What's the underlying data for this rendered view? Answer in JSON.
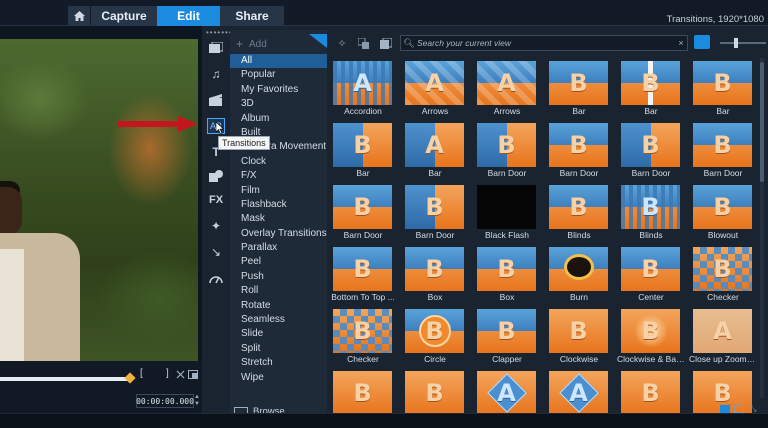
{
  "topbar": {
    "tabs": [
      {
        "label": "Capture"
      },
      {
        "label": "Edit"
      },
      {
        "label": "Share"
      }
    ],
    "project_info": "Transitions, 1920*1080"
  },
  "player": {
    "timecode": "00:00:00.000",
    "mark_in_glyph": "[",
    "mark_out_glyph": "]"
  },
  "library": {
    "add_label": "Add",
    "browse_label": "Browse",
    "search_placeholder": "Search your current view",
    "tooltip": "Transitions",
    "categories": [
      "All",
      "Popular",
      "My Favorites",
      "3D",
      "Album",
      "Built",
      "Camera Movement",
      "Clock",
      "F/X",
      "Film",
      "Flashback",
      "Mask",
      "Overlay Transitions",
      "Parallax",
      "Peel",
      "Push",
      "Roll",
      "Rotate",
      "Seamless",
      "Slide",
      "Split",
      "Stretch",
      "Wipe"
    ],
    "selected_category": "All",
    "side_icons": [
      "media-icon",
      "instant-project-icon",
      "sound-icon",
      "transitions-icon",
      "title-icon",
      "graphics-icon",
      "fx-icon",
      "effects-icon",
      "path-icon",
      "speed-icon"
    ],
    "fx_text": "FX",
    "thumbnails": [
      {
        "label": "Accordion",
        "style": "vbars",
        "letter": "A"
      },
      {
        "label": "Arrows",
        "style": "stripes",
        "letter": "A"
      },
      {
        "label": "Arrows",
        "style": "stripes",
        "letter": "A"
      },
      {
        "label": "Bar",
        "style": "sky",
        "letter": "B"
      },
      {
        "label": "Bar",
        "style": "split",
        "letter": "B"
      },
      {
        "label": "Bar",
        "style": "sky",
        "letter": "B"
      },
      {
        "label": "Bar",
        "style": "half",
        "letter": "B"
      },
      {
        "label": "Bar",
        "style": "half",
        "letter": "A"
      },
      {
        "label": "Barn Door",
        "style": "half",
        "letter": "B"
      },
      {
        "label": "Barn Door",
        "style": "sky",
        "letter": "B"
      },
      {
        "label": "Barn Door",
        "style": "half",
        "letter": "B"
      },
      {
        "label": "Barn Door",
        "style": "sky",
        "letter": "B"
      },
      {
        "label": "Barn Door",
        "style": "sky",
        "letter": "B"
      },
      {
        "label": "Barn Door",
        "style": "half",
        "letter": "B"
      },
      {
        "label": "Black Flash",
        "style": "black",
        "letter": ""
      },
      {
        "label": "Blinds",
        "style": "sky",
        "letter": "B"
      },
      {
        "label": "Blinds",
        "style": "vbars",
        "letter": "B"
      },
      {
        "label": "Blowout",
        "style": "sky",
        "letter": "B"
      },
      {
        "label": "Bottom To Top ...",
        "style": "sky",
        "letter": "B"
      },
      {
        "label": "Box",
        "style": "sky",
        "letter": "B"
      },
      {
        "label": "Box",
        "style": "sky",
        "letter": "B"
      },
      {
        "label": "Burn",
        "style": "hole",
        "letter": ""
      },
      {
        "label": "Center",
        "style": "sky",
        "letter": "B"
      },
      {
        "label": "Checker",
        "style": "checks",
        "letter": "B"
      },
      {
        "label": "Checker",
        "style": "checks",
        "letter": "B"
      },
      {
        "label": "Circle",
        "style": "circle",
        "letter": "B"
      },
      {
        "label": "Clapper",
        "style": "sky",
        "letter": "B"
      },
      {
        "label": "Clockwise",
        "style": "plain",
        "letter": "B"
      },
      {
        "label": "Clockwise & Bala...",
        "style": "glow",
        "letter": "B"
      },
      {
        "label": "Close up Zoom I...",
        "style": "dim",
        "letter": "A"
      },
      {
        "label": "",
        "style": "plain",
        "letter": "B"
      },
      {
        "label": "",
        "style": "plain",
        "letter": "B"
      },
      {
        "label": "",
        "style": "diamond",
        "letter": "A"
      },
      {
        "label": "",
        "style": "diamond",
        "letter": "A"
      },
      {
        "label": "",
        "style": "plain",
        "letter": "B"
      },
      {
        "label": "",
        "style": "plain",
        "letter": "B"
      }
    ]
  }
}
